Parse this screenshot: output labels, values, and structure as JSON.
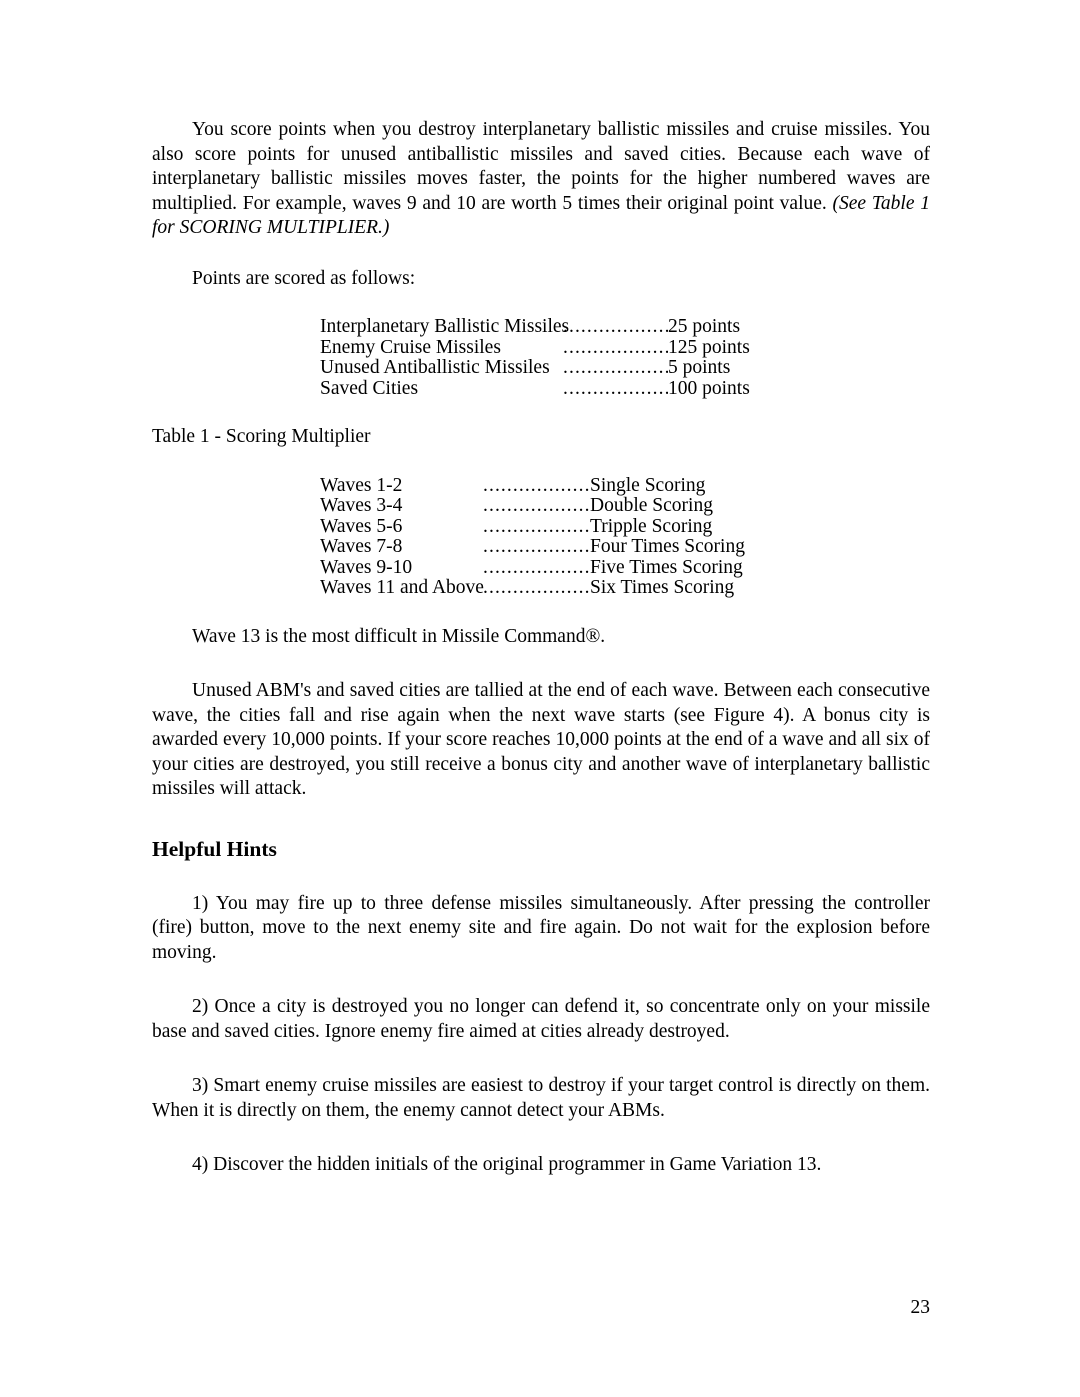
{
  "document": {
    "page_number": "23",
    "paragraphs": {
      "intro": "You score points when you destroy interplanetary ballistic missiles and cruise missiles. You also score points for unused antiballistic missiles and saved cities. Because each wave of interplanetary ballistic missiles moves faster, the points for the higher numbered waves are multiplied. For example, waves 9 and 10 are worth 5 times their original point value. ",
      "intro_italic_note": "(See Table 1 for SCORING MULTIPLIER.)",
      "points_lead_in": "Points are scored as follows:",
      "table_caption": "Table 1 - Scoring Multiplier",
      "wave_13_note": "Wave 13 is the most difficult in Missile Command®.",
      "tally_para": "Unused ABM's and saved cities are tallied at the end of each wave. Between each consecutive wave, the cities fall and rise again when the next wave starts (see Figure 4). A bonus city is awarded every 10,000 points. If your score reaches 10,000 points at the end of a wave and all six of your cities are destroyed, you still receive a bonus city and another wave of interplanetary ballistic missiles will attack."
    },
    "scoring_table": {
      "leader": "....................",
      "rows": [
        {
          "label": "Interplanetary Ballistic Missiles",
          "value": "25 points"
        },
        {
          "label": "Enemy Cruise Missiles",
          "value": "125 points"
        },
        {
          "label": "Unused Antiballistic Missiles",
          "value": "5 points"
        },
        {
          "label": "Saved Cities",
          "value": "100 points"
        }
      ]
    },
    "multiplier_table": {
      "leader": "....................",
      "rows": [
        {
          "label": "Waves 1-2",
          "value": "Single Scoring"
        },
        {
          "label": "Waves 3-4",
          "value": "Double Scoring"
        },
        {
          "label": "Waves 5-6",
          "value": "Tripple Scoring"
        },
        {
          "label": "Waves 7-8",
          "value": "Four Times Scoring"
        },
        {
          "label": "Waves 9-10",
          "value": "Five Times Scoring"
        },
        {
          "label": "Waves 11 and Above",
          "value": "Six Times Scoring"
        }
      ]
    },
    "helpful_hints": {
      "heading": "Helpful Hints",
      "items": [
        "1) You may fire up to three defense missiles simultaneously. After pressing the controller (fire) button, move to the next enemy site and fire again. Do not wait for the explosion before moving.",
        "2) Once a city is destroyed you no longer can defend it, so concentrate only on your missile base and saved cities. Ignore enemy fire aimed at cities already destroyed.",
        "3) Smart enemy cruise missiles are easiest to destroy if your target control is directly on them. When it is directly on them, the enemy cannot detect your ABMs.",
        "4) Discover the hidden initials of the original programmer in Game Variation 13."
      ]
    }
  }
}
